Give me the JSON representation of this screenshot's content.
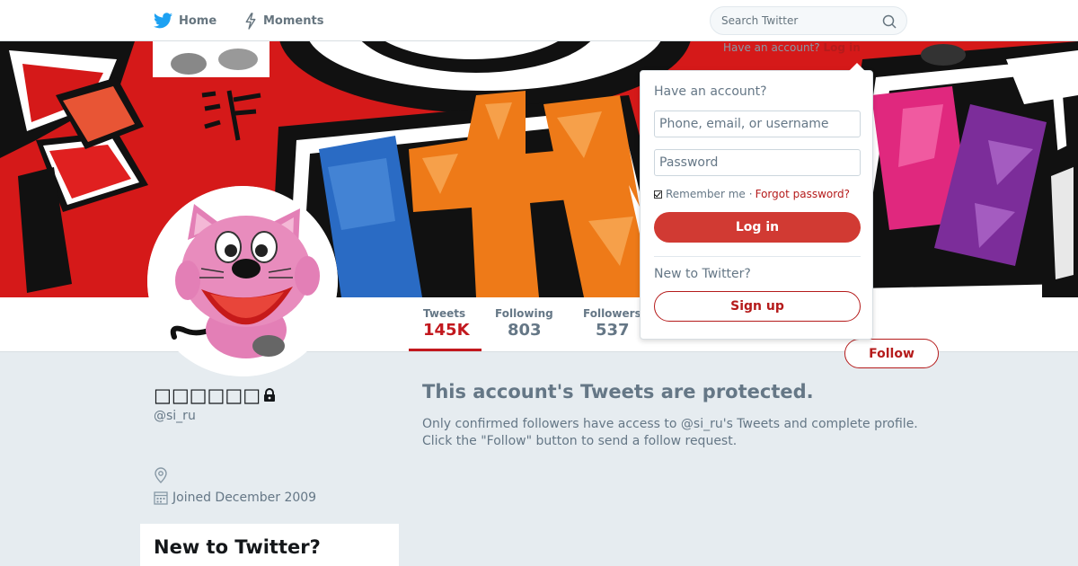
{
  "nav": {
    "home_label": "Home",
    "moments_label": "Moments",
    "search_placeholder": "Search Twitter"
  },
  "login_prompt": {
    "text": "Have an account?",
    "link": "Log in"
  },
  "profile_nav": {
    "stats": [
      {
        "label": "Tweets",
        "value": "145K"
      },
      {
        "label": "Following",
        "value": "803"
      },
      {
        "label": "Followers",
        "value": "537"
      }
    ],
    "follow_label": "Follow"
  },
  "profile": {
    "name": "□□□□□□",
    "handle": "@si_ru",
    "joined": "Joined December 2009"
  },
  "sidebar": {
    "new_to_twitter": "New to Twitter?"
  },
  "protected": {
    "title": "This account's Tweets are protected.",
    "line1": "Only confirmed followers have access to @si_ru's Tweets and complete profile.",
    "line2": "Click the \"Follow\" button to send a follow request."
  },
  "login_dropdown": {
    "title": "Have an account?",
    "username_placeholder": "Phone, email, or username",
    "password_placeholder": "Password",
    "remember_label": "Remember me",
    "separator": "·",
    "forgot_label": "Forgot password?",
    "login_label": "Log in",
    "new_label": "New to Twitter?",
    "signup_label": "Sign up"
  },
  "colors": {
    "accent": "#b51b1b",
    "login_button": "#d13a33",
    "page_bg": "#e6ecf0"
  },
  "icons": [
    "twitter-bird-icon",
    "lightning-icon",
    "search-icon",
    "lock-icon",
    "location-icon",
    "calendar-icon"
  ]
}
